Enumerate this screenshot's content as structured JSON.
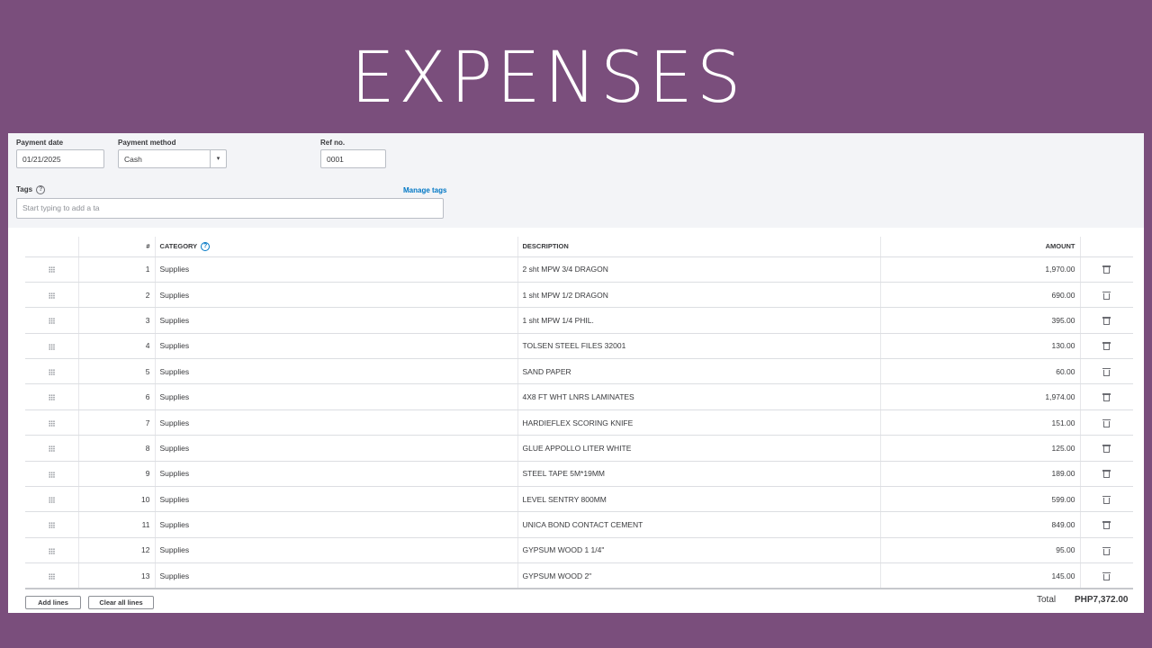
{
  "slide": {
    "title": "EXPENSES"
  },
  "form": {
    "payment_date": {
      "label": "Payment date",
      "value": "01/21/2025"
    },
    "payment_method": {
      "label": "Payment method",
      "value": "Cash",
      "caret": "▾"
    },
    "ref_no": {
      "label": "Ref no.",
      "value": "0001"
    },
    "tags": {
      "label": "Tags",
      "placeholder": "Start typing to add a ta",
      "manage_link": "Manage tags",
      "help": "?"
    }
  },
  "table": {
    "headers": {
      "num": "#",
      "category": "CATEGORY",
      "category_help": "?",
      "description": "DESCRIPTION",
      "amount": "AMOUNT"
    },
    "rows": [
      {
        "num": "1",
        "category": "Supplies",
        "description": "2 sht MPW 3/4 DRAGON",
        "amount": "1,970.00"
      },
      {
        "num": "2",
        "category": "Supplies",
        "description": "1 sht MPW 1/2 DRAGON",
        "amount": "690.00"
      },
      {
        "num": "3",
        "category": "Supplies",
        "description": "1 sht MPW 1/4 PHIL.",
        "amount": "395.00"
      },
      {
        "num": "4",
        "category": "Supplies",
        "description": "TOLSEN STEEL FILES 32001",
        "amount": "130.00"
      },
      {
        "num": "5",
        "category": "Supplies",
        "description": "SAND PAPER",
        "amount": "60.00"
      },
      {
        "num": "6",
        "category": "Supplies",
        "description": "4X8 FT WHT LNRS LAMINATES",
        "amount": "1,974.00"
      },
      {
        "num": "7",
        "category": "Supplies",
        "description": "HARDIEFLEX SCORING KNIFE",
        "amount": "151.00"
      },
      {
        "num": "8",
        "category": "Supplies",
        "description": "GLUE APPOLLO LITER WHITE",
        "amount": "125.00"
      },
      {
        "num": "9",
        "category": "Supplies",
        "description": "STEEL TAPE 5M*19MM",
        "amount": "189.00"
      },
      {
        "num": "10",
        "category": "Supplies",
        "description": "LEVEL SENTRY 800MM",
        "amount": "599.00"
      },
      {
        "num": "11",
        "category": "Supplies",
        "description": "UNICA BOND CONTACT CEMENT",
        "amount": "849.00"
      },
      {
        "num": "12",
        "category": "Supplies",
        "description": "GYPSUM WOOD 1 1/4\"",
        "amount": "95.00"
      },
      {
        "num": "13",
        "category": "Supplies",
        "description": "GYPSUM WOOD 2\"",
        "amount": "145.00"
      }
    ]
  },
  "footer": {
    "add_lines": "Add lines",
    "clear_all_lines": "Clear all lines",
    "total_label": "Total",
    "total_value": "PHP7,372.00"
  },
  "icons": {
    "drag": "drag-handle-icon",
    "delete": "trash-icon",
    "help": "help-circle-icon"
  },
  "colors": {
    "background": "#7a4e7c",
    "link": "#0077c5",
    "form_bg": "#f3f4f7"
  }
}
